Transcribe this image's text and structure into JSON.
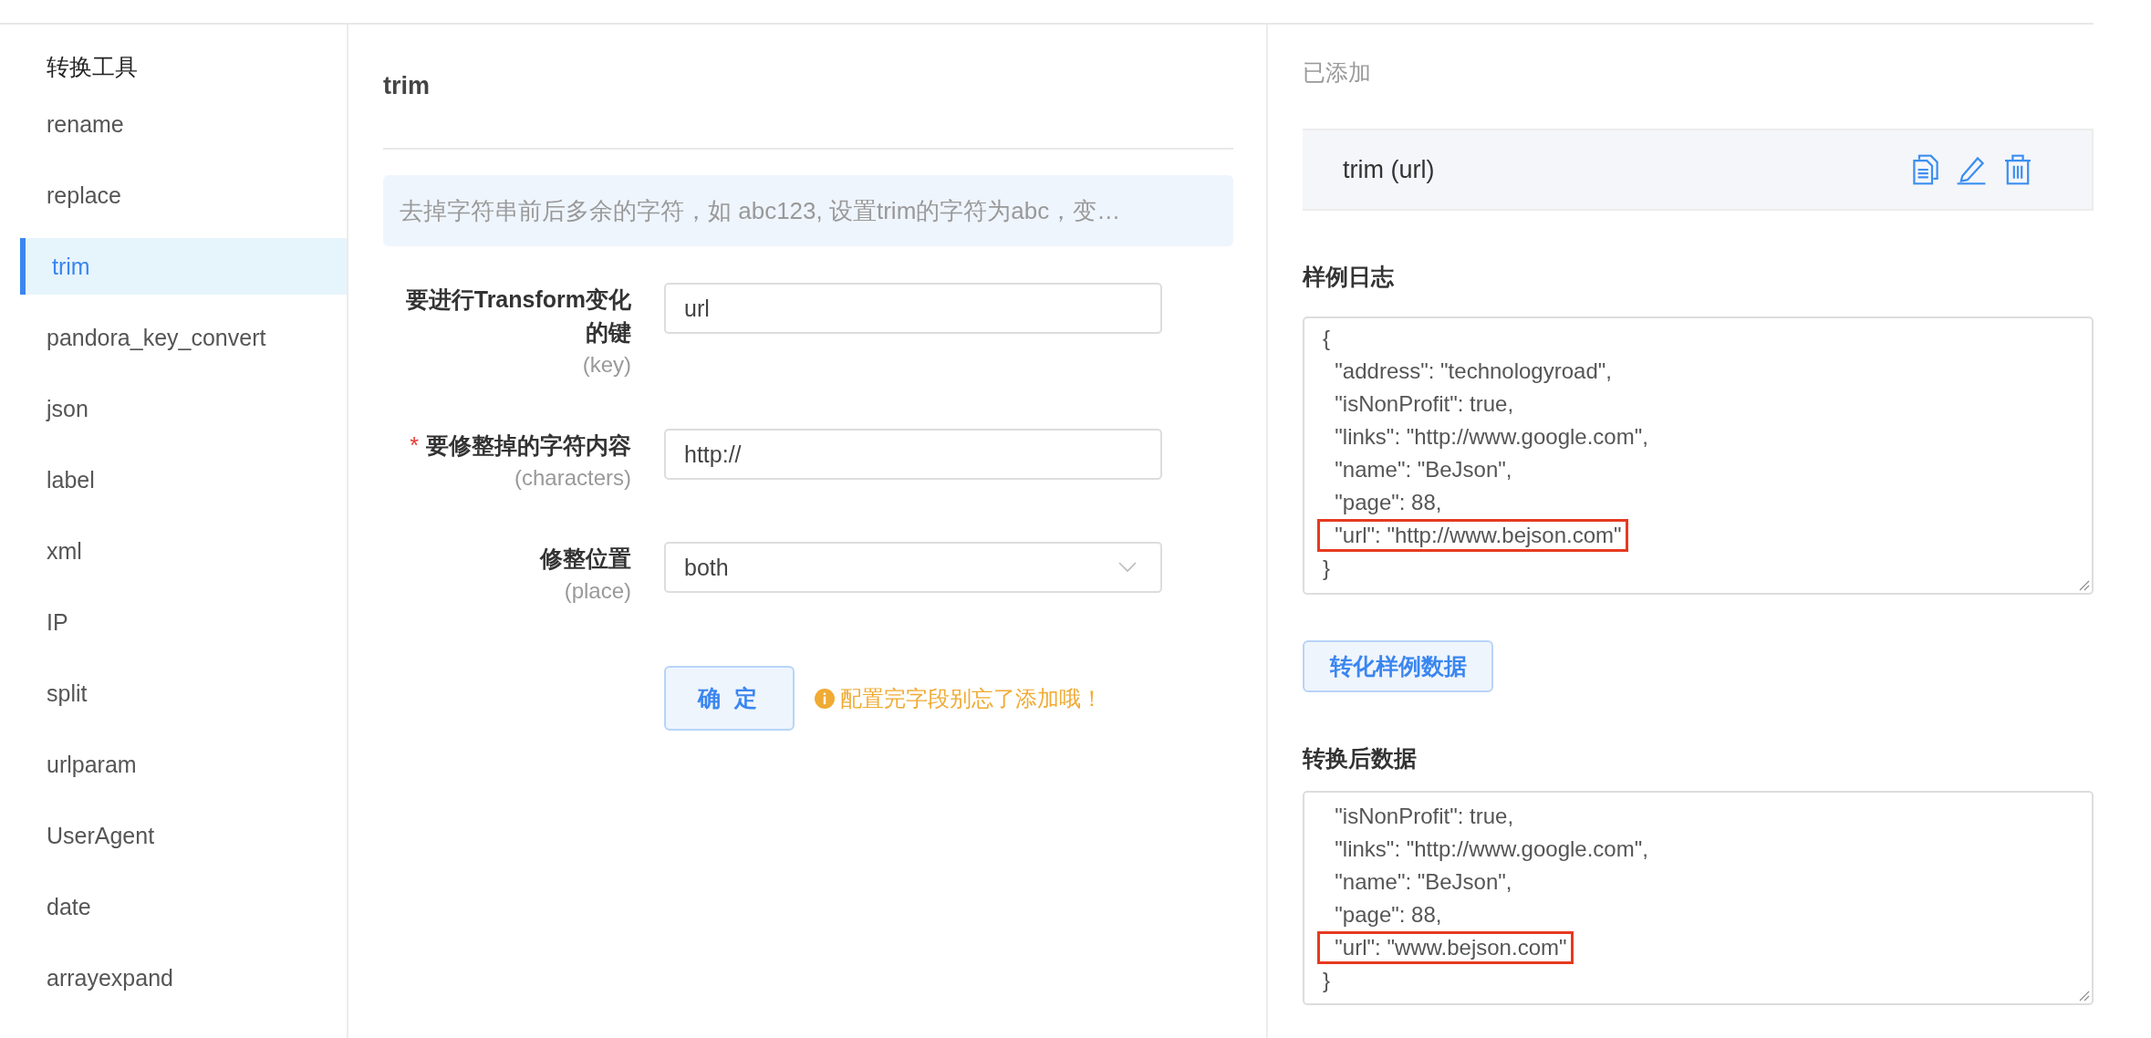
{
  "sidebar": {
    "title": "转换工具",
    "items": [
      {
        "label": "rename",
        "selected": false
      },
      {
        "label": "replace",
        "selected": false
      },
      {
        "label": "trim",
        "selected": true
      },
      {
        "label": "pandora_key_convert",
        "selected": false
      },
      {
        "label": "json",
        "selected": false
      },
      {
        "label": "label",
        "selected": false
      },
      {
        "label": "xml",
        "selected": false
      },
      {
        "label": "IP",
        "selected": false
      },
      {
        "label": "split",
        "selected": false
      },
      {
        "label": "urlparam",
        "selected": false
      },
      {
        "label": "UserAgent",
        "selected": false
      },
      {
        "label": "date",
        "selected": false
      },
      {
        "label": "arrayexpand",
        "selected": false
      }
    ]
  },
  "form": {
    "title": "trim",
    "description": "去掉字符串前后多余的字符，如 abc123, 设置trim的字符为abc，变…",
    "fields": [
      {
        "kind": "input",
        "label": "要进行Transform变化的键",
        "hint": "(key)",
        "value": "url"
      },
      {
        "kind": "input",
        "label": "要修整掉的字符内容",
        "hint": "(characters)",
        "required_mark": "*",
        "value": "http://"
      },
      {
        "kind": "select",
        "label": "修整位置",
        "hint": "(place)",
        "value": "both"
      }
    ],
    "submit": "确 定",
    "tip": "配置完字段别忘了添加哦！"
  },
  "added": {
    "title": "已添加",
    "items": [
      {
        "label": "trim (url)"
      }
    ]
  },
  "sample_log": {
    "title": "样例日志",
    "lines": [
      {
        "text": "{",
        "highlighted": false
      },
      {
        "text": "  \"address\": \"technologyroad\",",
        "highlighted": false
      },
      {
        "text": "  \"isNonProfit\": true,",
        "highlighted": false
      },
      {
        "text": "  \"links\": \"http://www.google.com\",",
        "highlighted": false
      },
      {
        "text": "  \"name\": \"BeJson\",",
        "highlighted": false
      },
      {
        "text": "  \"page\": 88,",
        "highlighted": false
      },
      {
        "text": "  \"url\": \"http://www.bejson.com\"",
        "highlighted": true
      },
      {
        "text": "}",
        "highlighted": false
      }
    ]
  },
  "convert_button": "转化样例数据",
  "result": {
    "title": "转换后数据",
    "lines": [
      {
        "text": "  \"isNonProfit\": true,",
        "highlighted": false
      },
      {
        "text": "  \"links\": \"http://www.google.com\",",
        "highlighted": false
      },
      {
        "text": "  \"name\": \"BeJson\",",
        "highlighted": false
      },
      {
        "text": "  \"page\": 88,",
        "highlighted": false
      },
      {
        "text": "  \"url\": \"www.bejson.com\"",
        "highlighted": true
      },
      {
        "text": "}",
        "highlighted": false
      }
    ]
  }
}
